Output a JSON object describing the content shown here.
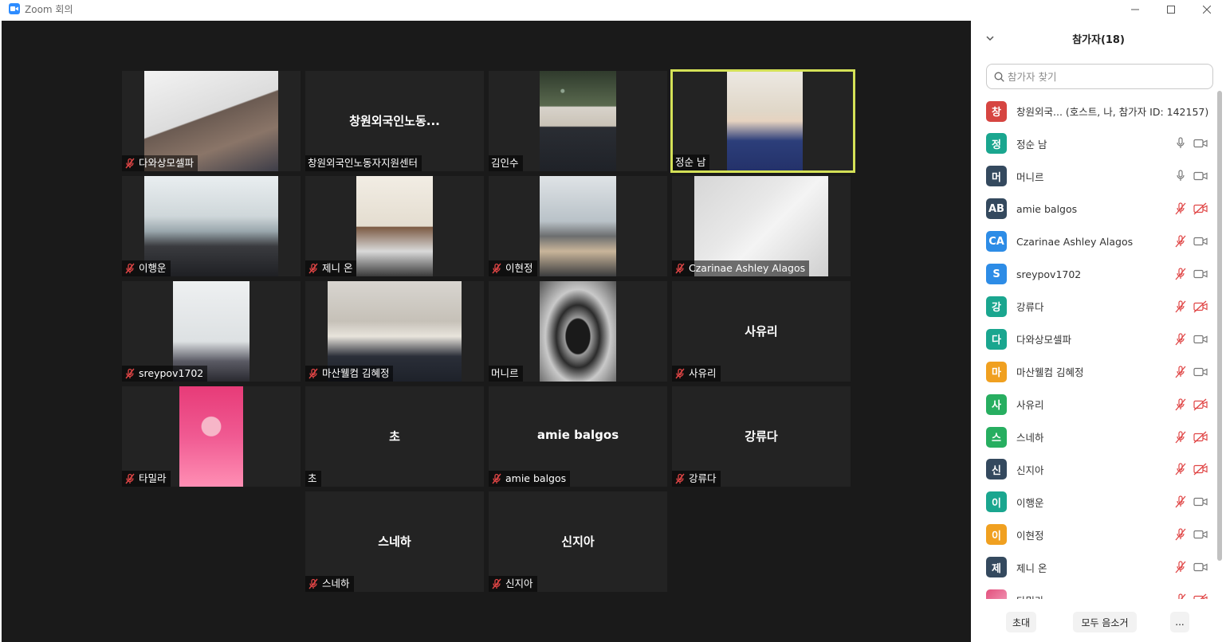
{
  "window": {
    "title": "Zoom 회의"
  },
  "tiles": [
    {
      "name": "다와상모셀파",
      "muted": true,
      "video": "v1"
    },
    {
      "name": "창원외국인노동자지원센터",
      "muted": false,
      "big": "창원외국인노동...",
      "video": null
    },
    {
      "name": "김인수",
      "muted": false,
      "video": "v3"
    },
    {
      "name": "정순 남",
      "muted": false,
      "video": "v4",
      "active": true
    },
    {
      "name": "이행운",
      "muted": true,
      "video": "v5"
    },
    {
      "name": "제니 온",
      "muted": true,
      "video": "v6"
    },
    {
      "name": "이현정",
      "muted": true,
      "video": "v7"
    },
    {
      "name": "Czarinae Ashley Alagos",
      "muted": true,
      "video": "v8"
    },
    {
      "name": "sreypov1702",
      "muted": true,
      "video": "v9"
    },
    {
      "name": "마산웰컴 김혜정",
      "muted": true,
      "video": "v10"
    },
    {
      "name": "머니르",
      "muted": false,
      "video": "v11"
    },
    {
      "name": "사유리",
      "muted": true,
      "big": "사유리",
      "video": null
    },
    {
      "name": "타밀라",
      "muted": true,
      "video": "v13"
    },
    {
      "name": "초",
      "muted": false,
      "big": "초",
      "video": null
    },
    {
      "name": "amie balgos",
      "muted": true,
      "big": "amie balgos",
      "video": null
    },
    {
      "name": "강류다",
      "muted": true,
      "big": "강류다",
      "video": null
    },
    {
      "name": "스네하",
      "muted": true,
      "big": "스네하",
      "video": null
    },
    {
      "name": "신지아",
      "muted": true,
      "big": "신지아",
      "video": null
    }
  ],
  "panel": {
    "title": "참가자(18)",
    "search_placeholder": "참가자 찾기",
    "participants": [
      {
        "initial": "창",
        "color": "#d64541",
        "name": "창원외국... (호스트, 나, 참가자 ID: 142157)",
        "mic": "none",
        "cam": "none"
      },
      {
        "initial": "정",
        "color": "#1aa68f",
        "name": "정순 남",
        "mic": "on",
        "cam": "on"
      },
      {
        "initial": "머",
        "color": "#34495e",
        "name": "머니르",
        "mic": "on",
        "cam": "on"
      },
      {
        "initial": "AB",
        "color": "#34495e",
        "name": "amie balgos",
        "mic": "off",
        "cam": "off"
      },
      {
        "initial": "CA",
        "color": "#2d8ce6",
        "name": "Czarinae Ashley Alagos",
        "mic": "off",
        "cam": "on"
      },
      {
        "initial": "S",
        "color": "#2d8ce6",
        "name": "sreypov1702",
        "mic": "off",
        "cam": "on"
      },
      {
        "initial": "강",
        "color": "#1aa68f",
        "name": "강류다",
        "mic": "off",
        "cam": "off"
      },
      {
        "initial": "다",
        "color": "#1aa68f",
        "name": "다와상모셀파",
        "mic": "off",
        "cam": "on"
      },
      {
        "initial": "마",
        "color": "#f0a020",
        "name": "마산웰컴 김혜정",
        "mic": "off",
        "cam": "on"
      },
      {
        "initial": "사",
        "color": "#27ae60",
        "name": "사유리",
        "mic": "off",
        "cam": "off"
      },
      {
        "initial": "스",
        "color": "#27ae60",
        "name": "스네하",
        "mic": "off",
        "cam": "off"
      },
      {
        "initial": "신",
        "color": "#34495e",
        "name": "신지아",
        "mic": "off",
        "cam": "off"
      },
      {
        "initial": "이",
        "color": "#1aa68f",
        "name": "이행운",
        "mic": "off",
        "cam": "on"
      },
      {
        "initial": "이",
        "color": "#f0a020",
        "name": "이현정",
        "mic": "off",
        "cam": "on"
      },
      {
        "initial": "제",
        "color": "#34495e",
        "name": "제니 온",
        "mic": "off",
        "cam": "on"
      },
      {
        "initial": "",
        "color": "#e2507c",
        "name": "타밀라",
        "mic": "off",
        "cam": "off"
      }
    ],
    "footer": {
      "invite": "초대",
      "mute_all": "모두 음소거",
      "more": "..."
    }
  }
}
